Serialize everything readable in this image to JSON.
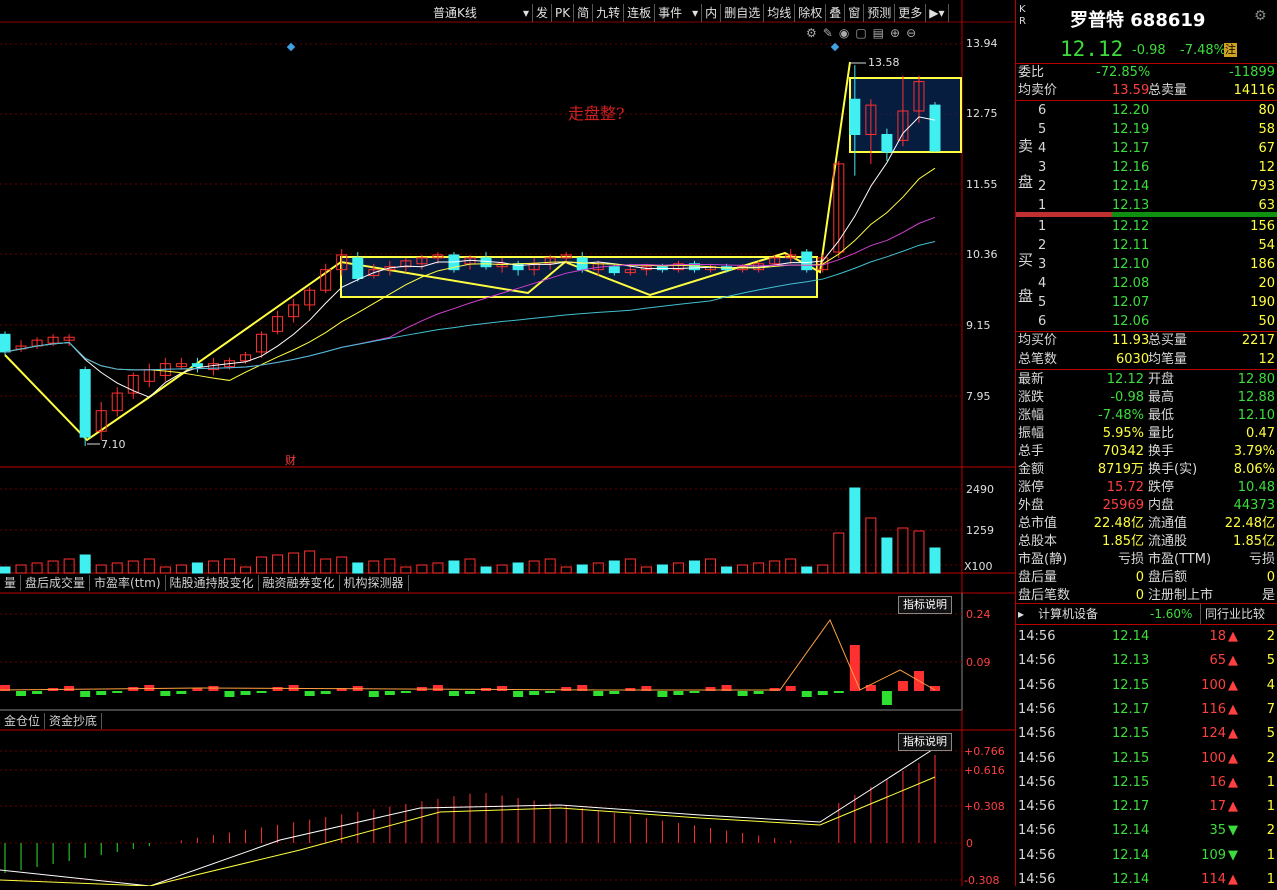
{
  "toolbar": {
    "items": [
      "普通K线",
      "发",
      "PK",
      "简",
      "九转",
      "连板",
      "事件",
      "内",
      "删自选",
      "均线",
      "除权",
      "叠",
      "窗",
      "预测",
      "更多"
    ]
  },
  "main_chart": {
    "price_labels": [
      "13.94",
      "12.75",
      "11.55",
      "10.36",
      "9.15",
      "7.95"
    ],
    "high_marker": "13.58",
    "low_marker": "7.10",
    "annotation": "走盘整?",
    "fin_marker": "财"
  },
  "volume_chart": {
    "labels": [
      "2490",
      "1259"
    ],
    "unit": "X100"
  },
  "indicator_tabs1": [
    "量",
    "盘后成交量",
    "市盈率(ttm)",
    "陆股通持股变化",
    "融资融券变化",
    "机构探测器"
  ],
  "indicator1": {
    "help": "指标说明",
    "labels": [
      "0.24",
      "0.09"
    ]
  },
  "indicator_tabs2": [
    "金仓位",
    "资金抄底"
  ],
  "indicator2": {
    "help": "指标说明",
    "labels": [
      "+0.766",
      "+0.616",
      "+0.308",
      "0",
      "-0.308"
    ]
  },
  "stock": {
    "side_chars": [
      "K",
      "R"
    ],
    "name": "罗普特 688619",
    "price": "12.12",
    "change": "-0.98",
    "change_pct": "-7.48%",
    "tag": "注",
    "weibi_label": "委比",
    "weibi_pct": "-72.85%",
    "weibi_val": "-11899",
    "avg_sell_label": "均卖价",
    "avg_sell": "13.59",
    "total_sell_label": "总卖量",
    "total_sell": "14116",
    "sell_side_label": [
      "卖",
      "盘"
    ],
    "buy_side_label": [
      "买",
      "盘"
    ],
    "sells": [
      {
        "lvl": "6",
        "price": "12.20",
        "vol": "80"
      },
      {
        "lvl": "5",
        "price": "12.19",
        "vol": "58"
      },
      {
        "lvl": "4",
        "price": "12.17",
        "vol": "67"
      },
      {
        "lvl": "3",
        "price": "12.16",
        "vol": "12"
      },
      {
        "lvl": "2",
        "price": "12.14",
        "vol": "793"
      },
      {
        "lvl": "1",
        "price": "12.13",
        "vol": "63"
      }
    ],
    "buys": [
      {
        "lvl": "1",
        "price": "12.12",
        "vol": "156"
      },
      {
        "lvl": "2",
        "price": "12.11",
        "vol": "54"
      },
      {
        "lvl": "3",
        "price": "12.10",
        "vol": "186"
      },
      {
        "lvl": "4",
        "price": "12.08",
        "vol": "20"
      },
      {
        "lvl": "5",
        "price": "12.07",
        "vol": "190"
      },
      {
        "lvl": "6",
        "price": "12.06",
        "vol": "50"
      }
    ],
    "avg_buy_label": "均买价",
    "avg_buy": "11.93",
    "total_buy_label": "总买量",
    "total_buy": "2217",
    "trades_label": "总笔数",
    "trades": "6030",
    "avg_trade_label": "均笔量",
    "avg_trade": "12"
  },
  "stats": [
    {
      "l1": "最新",
      "v1": "12.12",
      "c1": "gr",
      "l2": "开盘",
      "v2": "12.80",
      "c2": "gr"
    },
    {
      "l1": "涨跌",
      "v1": "-0.98",
      "c1": "gr",
      "l2": "最高",
      "v2": "12.88",
      "c2": "gr"
    },
    {
      "l1": "涨幅",
      "v1": "-7.48%",
      "c1": "gr",
      "l2": "最低",
      "v2": "12.10",
      "c2": "gr"
    },
    {
      "l1": "振幅",
      "v1": "5.95%",
      "c1": "yl",
      "l2": "量比",
      "v2": "0.47",
      "c2": "yl"
    },
    {
      "l1": "总手",
      "v1": "70342",
      "c1": "yl",
      "l2": "换手",
      "v2": "3.79%",
      "c2": "yl"
    },
    {
      "l1": "金额",
      "v1": "8719万",
      "c1": "yl",
      "l2": "换手(实)",
      "v2": "8.06%",
      "c2": "yl"
    },
    {
      "l1": "涨停",
      "v1": "15.72",
      "c1": "rd",
      "l2": "跌停",
      "v2": "10.48",
      "c2": "gr"
    },
    {
      "l1": "外盘",
      "v1": "25969",
      "c1": "rd",
      "l2": "内盘",
      "v2": "44373",
      "c2": "gr"
    },
    {
      "l1": "总市值",
      "v1": "22.48亿",
      "c1": "yl",
      "l2": "流通值",
      "v2": "22.48亿",
      "c2": "yl"
    },
    {
      "l1": "总股本",
      "v1": "1.85亿",
      "c1": "yl",
      "l2": "流通股",
      "v2": "1.85亿",
      "c2": "yl"
    },
    {
      "l1": "市盈(静)",
      "v1": "亏损",
      "c1": "wh",
      "l2": "市盈(TTM)",
      "v2": "亏损",
      "c2": "wh"
    },
    {
      "l1": "盘后量",
      "v1": "0",
      "c1": "yl",
      "l2": "盘后额",
      "v2": "0",
      "c2": "yl"
    },
    {
      "l1": "盘后笔数",
      "v1": "0",
      "c1": "yl",
      "l2": "注册制上市",
      "v2": "是",
      "c2": "wh"
    }
  ],
  "sector": {
    "name": "计算机设备",
    "pct": "-1.60%",
    "compare": "同行业比较"
  },
  "ticks": [
    {
      "time": "14:56",
      "price": "12.14",
      "vol": "18",
      "dir": "up",
      "n": "2"
    },
    {
      "time": "14:56",
      "price": "12.13",
      "vol": "65",
      "dir": "up",
      "n": "5"
    },
    {
      "time": "14:56",
      "price": "12.15",
      "vol": "100",
      "dir": "up",
      "n": "4"
    },
    {
      "time": "14:56",
      "price": "12.17",
      "vol": "116",
      "dir": "up",
      "n": "7"
    },
    {
      "time": "14:56",
      "price": "12.15",
      "vol": "124",
      "dir": "up",
      "n": "5"
    },
    {
      "time": "14:56",
      "price": "12.15",
      "vol": "100",
      "dir": "up",
      "n": "2"
    },
    {
      "time": "14:56",
      "price": "12.15",
      "vol": "16",
      "dir": "up",
      "n": "1"
    },
    {
      "time": "14:56",
      "price": "12.17",
      "vol": "17",
      "dir": "up",
      "n": "1"
    },
    {
      "time": "14:56",
      "price": "12.14",
      "vol": "35",
      "dir": "down",
      "n": "2"
    },
    {
      "time": "14:56",
      "price": "12.14",
      "vol": "109",
      "dir": "down",
      "n": "1"
    },
    {
      "time": "14:56",
      "price": "12.14",
      "vol": "114",
      "dir": "up",
      "n": "1"
    }
  ],
  "colors": {
    "up": "#ff3030",
    "down": "#40f0f0",
    "ma5": "#ffffff",
    "ma10": "#ffff40",
    "ma20": "#d040d0",
    "ma60": "#40c0d0",
    "box": "#ffff40"
  }
}
